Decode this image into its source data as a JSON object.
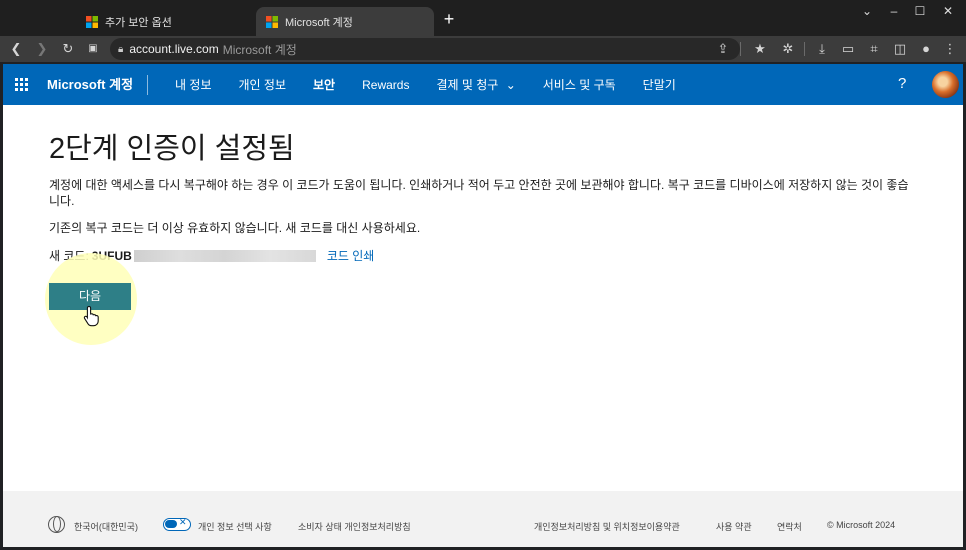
{
  "browser": {
    "tabs": [
      {
        "title": "추가 보안 옵션"
      },
      {
        "title": "Microsoft 계정"
      }
    ],
    "url_host": "account.live.com",
    "url_title": "Microsoft 계정"
  },
  "header": {
    "brand": "Microsoft 계정",
    "nav": [
      "내 정보",
      "개인 정보",
      "보안",
      "Rewards",
      "결제 및 청구",
      "서비스 및 구독",
      "단말기"
    ],
    "help": "?"
  },
  "main": {
    "title": "2단계 인증이 설정됨",
    "paragraph1": "계정에 대한 액세스를 다시 복구해야 하는 경우 이 코드가 도움이 됩니다. 인쇄하거나 적어 두고 안전한 곳에 보관해야 합니다. 복구 코드를 디바이스에 저장하지 않는 것이 좋습니다.",
    "paragraph2": "기존의 복구 코드는 더 이상 유효하지 않습니다. 새 코드를 대신 사용하세요.",
    "new_code_label": "새 코드:",
    "new_code_visible": "3UFUB",
    "print_link": "코드 인쇄",
    "next_button": "다음"
  },
  "footer": {
    "language": "한국어(대한민국)",
    "privacy_choices": "개인 정보 선택 사항",
    "consumer_health": "소비자 상태 개인정보처리방침",
    "privacy_terms": "개인정보처리방침 및 위치정보이용약관",
    "terms": "사용 약관",
    "contact": "연락처",
    "copyright": "© Microsoft 2024"
  },
  "colors": {
    "ms_blue": "#0067b8",
    "button_teal": "#2e7f87",
    "highlight": "#ffffb7"
  }
}
